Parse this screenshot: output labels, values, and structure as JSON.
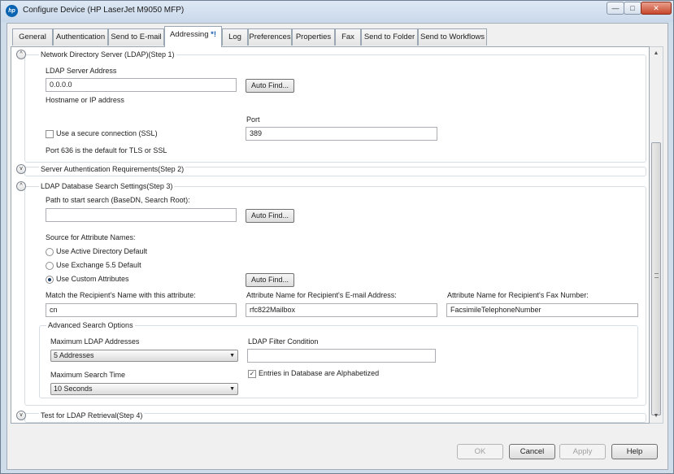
{
  "window": {
    "title": "Configure Device (HP LaserJet M9050 MFP)",
    "logo_text": "hp",
    "minimize": "—",
    "maximize": "□",
    "close": "✕"
  },
  "tabs": [
    {
      "label": "General"
    },
    {
      "label": "Authentication"
    },
    {
      "label": "Send to E-mail"
    },
    {
      "label": "Addressing",
      "marker": "*!",
      "active": true
    },
    {
      "label": "Log"
    },
    {
      "label": "Preferences"
    },
    {
      "label": "Properties"
    },
    {
      "label": "Fax"
    },
    {
      "label": "Send to Folder"
    },
    {
      "label": "Send to Workflows"
    }
  ],
  "step1": {
    "title": "Network Directory Server (LDAP)(Step 1)",
    "server_address_label": "LDAP Server Address",
    "server_address_value": "0.0.0.0",
    "auto_find": "Auto Find...",
    "hostname_hint": "Hostname or IP address",
    "port_label": "Port",
    "port_value": "389",
    "ssl_label": "Use a secure connection (SSL)",
    "ssl_checked": false,
    "ssl_hint": "Port 636 is the default for TLS or SSL"
  },
  "step2": {
    "title": "Server Authentication Requirements(Step 2)"
  },
  "step3": {
    "title": "LDAP Database Search Settings(Step 3)",
    "path_label": "Path to start search (BaseDN, Search Root):",
    "path_value": "",
    "auto_find": "Auto Find...",
    "source_label": "Source for Attribute Names:",
    "radio_active_directory": "Use Active Directory Default",
    "radio_exchange": "Use Exchange 5.5 Default",
    "radio_custom": "Use Custom Attributes",
    "selected_source": "custom",
    "auto_find_custom": "Auto Find...",
    "match_name_label": "Match the Recipient's Name with this attribute:",
    "match_name_value": "cn",
    "email_attr_label": "Attribute Name for Recipient's E-mail Address:",
    "email_attr_value": "rfc822Mailbox",
    "fax_attr_label": "Attribute Name for Recipient's Fax Number:",
    "fax_attr_value": "FacsimileTelephoneNumber",
    "advanced": {
      "title": "Advanced Search Options",
      "max_addresses_label": "Maximum LDAP Addresses",
      "max_addresses_value": "5 Addresses",
      "filter_label": "LDAP Filter Condition",
      "filter_value": "",
      "max_time_label": "Maximum Search Time",
      "max_time_value": "10 Seconds",
      "alphabetized_label": "Entries in Database are Alphabetized",
      "alphabetized_checked": true
    }
  },
  "step4": {
    "title": "Test for LDAP Retrieval(Step 4)"
  },
  "icons": {
    "expanded": "^",
    "collapsed": "v",
    "dropdown": "▼",
    "check": "✓"
  },
  "footer": {
    "ok": "OK",
    "cancel": "Cancel",
    "apply": "Apply",
    "help": "Help"
  }
}
